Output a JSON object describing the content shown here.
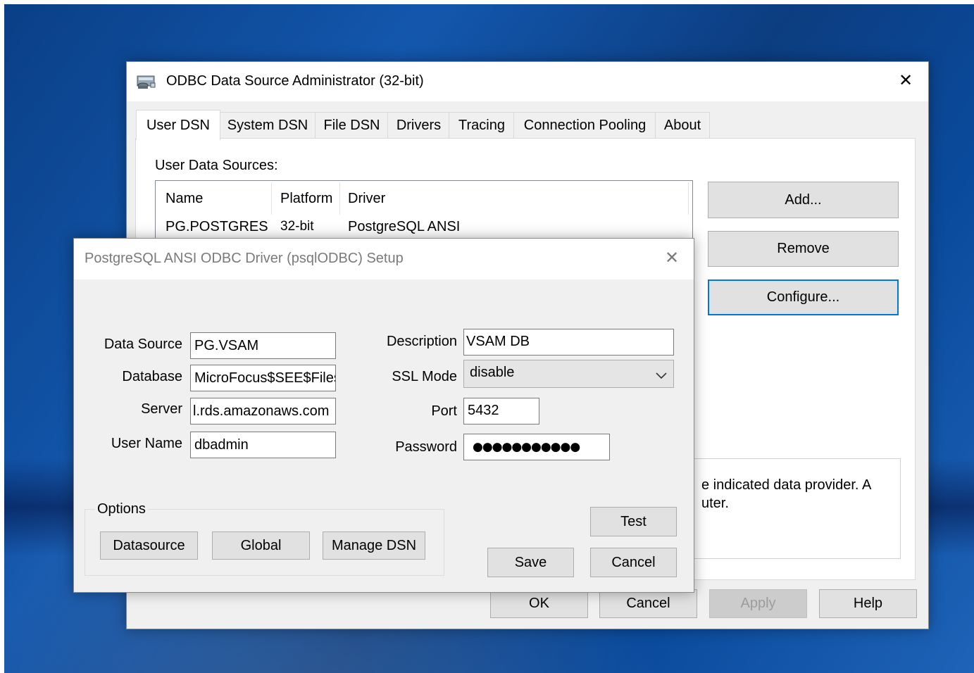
{
  "odbc": {
    "title": "ODBC Data Source Administrator (32-bit)",
    "close_glyph": "✕",
    "tabs": [
      {
        "label": "User DSN"
      },
      {
        "label": "System DSN"
      },
      {
        "label": "File DSN"
      },
      {
        "label": "Drivers"
      },
      {
        "label": "Tracing"
      },
      {
        "label": "Connection Pooling"
      },
      {
        "label": "About"
      }
    ],
    "active_tab": "User DSN",
    "list_caption": "User Data Sources:",
    "columns": [
      "Name",
      "Platform",
      "Driver"
    ],
    "rows": [
      {
        "name": "PG.POSTGRES",
        "platform": "32-bit",
        "driver": "PostgreSQL ANSI"
      }
    ],
    "side_buttons": {
      "add": "Add...",
      "remove": "Remove",
      "configure": "Configure..."
    },
    "info_text_line1": "e indicated data provider.   A",
    "info_text_line2": "uter.",
    "footer_buttons": {
      "ok": "OK",
      "cancel": "Cancel",
      "apply": "Apply",
      "help": "Help"
    }
  },
  "setup": {
    "title": "PostgreSQL ANSI ODBC Driver (psqlODBC) Setup",
    "close_glyph": "✕",
    "labels": {
      "data_source": "Data Source",
      "database": "Database",
      "server": "Server",
      "user_name": "User Name",
      "description": "Description",
      "ssl_mode": "SSL Mode",
      "port": "Port",
      "password": "Password"
    },
    "values": {
      "data_source": "PG.VSAM",
      "database": "MicroFocus$SEE$Files",
      "server": "l.rds.amazonaws.com",
      "user_name": "dbadmin",
      "description": "VSAM DB",
      "ssl_mode": "disable",
      "port": "5432",
      "password": "●●●●●●●●●●●"
    },
    "options_legend": "Options",
    "option_buttons": {
      "datasource": "Datasource",
      "global": "Global",
      "manage_dsn": "Manage DSN"
    },
    "action_buttons": {
      "test": "Test",
      "save": "Save",
      "cancel": "Cancel"
    }
  },
  "colors": {
    "accent": "#0078d7",
    "desktop": "#1357ad"
  }
}
